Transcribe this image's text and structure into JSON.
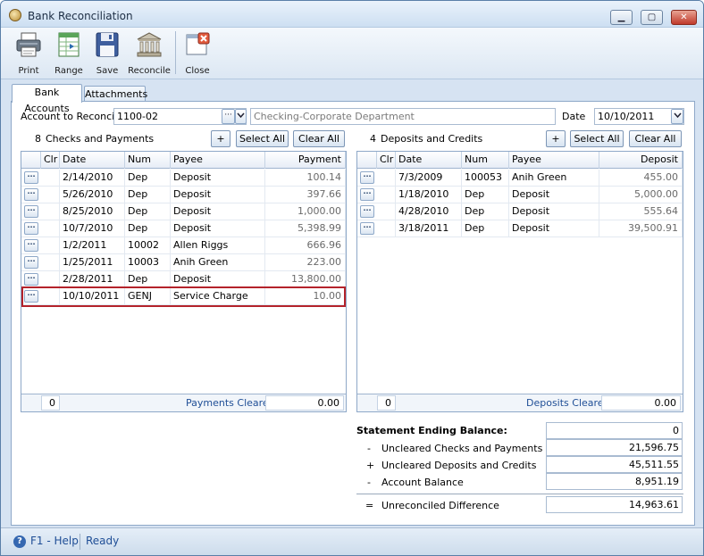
{
  "window": {
    "title": "Bank Reconciliation",
    "min_glyph": "▁",
    "max_glyph": "▢",
    "close_glyph": "✕"
  },
  "toolbar": [
    {
      "key": "print",
      "label": "Print",
      "icon": "printer-icon"
    },
    {
      "key": "range",
      "label": "Range",
      "icon": "spreadsheet-icon"
    },
    {
      "key": "save",
      "label": "Save",
      "icon": "floppy-disk-icon"
    },
    {
      "key": "reconcile",
      "label": "Reconcile",
      "icon": "bank-building-icon"
    },
    {
      "key": "close",
      "label": "Close",
      "icon": "close-window-icon"
    }
  ],
  "tabs": [
    {
      "label": "Bank Accounts",
      "active": true
    },
    {
      "label": "Attachments",
      "active": false
    }
  ],
  "account": {
    "label": "Account to Reconcile",
    "value": "1100-02",
    "description": "Checking-Corporate Department",
    "date_label": "Date",
    "date_value": "10/10/2011"
  },
  "checks": {
    "count": "8",
    "title": "Checks and Payments",
    "add_label": "+",
    "select_all": "Select All",
    "clear_all": "Clear All",
    "columns": {
      "clr": "Clr",
      "date": "Date",
      "num": "Num",
      "payee": "Payee",
      "amount": "Payment"
    },
    "rows": [
      {
        "date": "2/14/2010",
        "num": "Dep",
        "payee": "Deposit",
        "amount": "100.14"
      },
      {
        "date": "5/26/2010",
        "num": "Dep",
        "payee": "Deposit",
        "amount": "397.66"
      },
      {
        "date": "8/25/2010",
        "num": "Dep",
        "payee": "Deposit",
        "amount": "1,000.00"
      },
      {
        "date": "10/7/2010",
        "num": "Dep",
        "payee": "Deposit",
        "amount": "5,398.99"
      },
      {
        "date": "1/2/2011",
        "num": "10002",
        "payee": "Allen Riggs",
        "amount": "666.96"
      },
      {
        "date": "1/25/2011",
        "num": "10003",
        "payee": "Anih Green",
        "amount": "223.00"
      },
      {
        "date": "2/28/2011",
        "num": "Dep",
        "payee": "Deposit",
        "amount": "13,800.00"
      },
      {
        "date": "10/10/2011",
        "num": "GENJ",
        "payee": "Service Charge",
        "amount": "10.00"
      }
    ],
    "footer": {
      "count": "0",
      "label": "Payments Cleared",
      "total": "0.00"
    }
  },
  "deposits": {
    "count": "4",
    "title": "Deposits and Credits",
    "add_label": "+",
    "select_all": "Select All",
    "clear_all": "Clear All",
    "columns": {
      "clr": "Clr",
      "date": "Date",
      "num": "Num",
      "payee": "Payee",
      "amount": "Deposit"
    },
    "rows": [
      {
        "date": "7/3/2009",
        "num": "100053",
        "payee": "Anih Green",
        "amount": "455.00"
      },
      {
        "date": "1/18/2010",
        "num": "Dep",
        "payee": "Deposit",
        "amount": "5,000.00"
      },
      {
        "date": "4/28/2010",
        "num": "Dep",
        "payee": "Deposit",
        "amount": "555.64"
      },
      {
        "date": "3/18/2011",
        "num": "Dep",
        "payee": "Deposit",
        "amount": "39,500.91"
      }
    ],
    "footer": {
      "count": "0",
      "label": "Deposits Cleared",
      "total": "0.00"
    }
  },
  "summary": {
    "ending_label": "Statement Ending Balance:",
    "ending_value": "0",
    "uncleared_checks_sign": "-",
    "uncleared_checks_label": "Uncleared Checks and Payments",
    "uncleared_checks_value": "21,596.75",
    "uncleared_deposits_sign": "+",
    "uncleared_deposits_label": "Uncleared Deposits and Credits",
    "uncleared_deposits_value": "45,511.55",
    "account_balance_sign": "-",
    "account_balance_label": "Account Balance",
    "account_balance_value": "8,951.19",
    "diff_sign": "=",
    "diff_label": "Unreconciled Difference",
    "diff_value": "14,963.61"
  },
  "status": {
    "help": "F1 - Help",
    "state": "Ready"
  }
}
